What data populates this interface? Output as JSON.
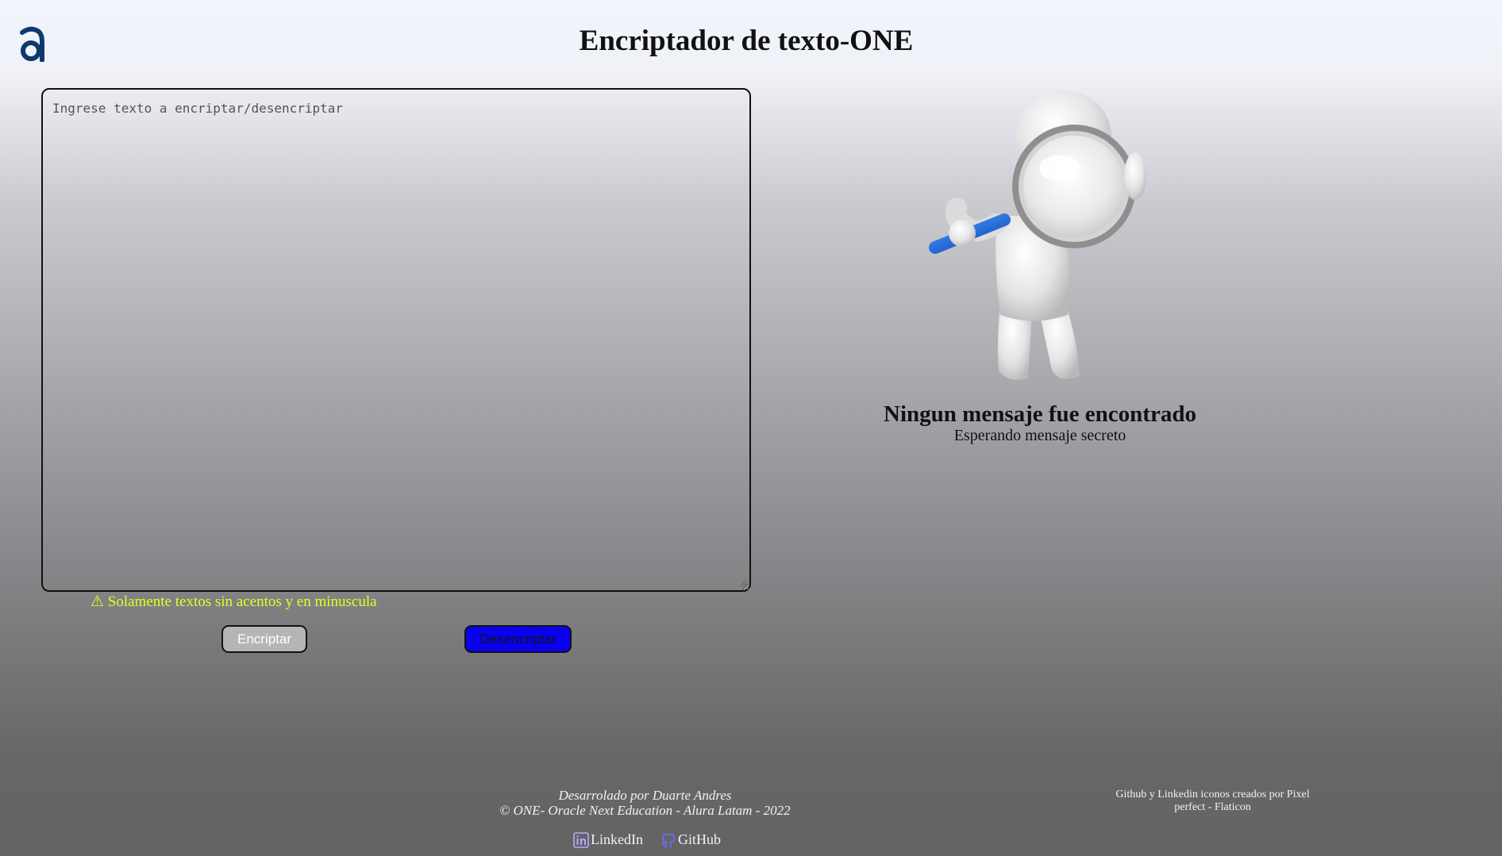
{
  "header": {
    "logo_icon": "alura-logo-icon",
    "title": "Encriptador de texto-ONE"
  },
  "input": {
    "placeholder": "Ingrese texto a encriptar/desencriptar",
    "value": ""
  },
  "warning": {
    "icon": "warning-icon",
    "text": "⚠ Solamente textos sin acentos y en minuscula"
  },
  "actions": {
    "encrypt_label": "Encriptar",
    "decrypt_label": "Desencriptar"
  },
  "output": {
    "image": "magnifier-figure-illustration",
    "title": "Ningun mensaje fue encontrado",
    "subtitle": "Esperando mensaje secreto"
  },
  "footer": {
    "developed_by": "Desarrolado por Duarte Andres",
    "copyright": "© ONE- Oracle Next Education - Alura Latam - 2022",
    "linkedin_label": "LinkedIn",
    "github_label": "GitHub",
    "icon_credit": "Github y Linkedin iconos creados por Pixel perfect - Flaticon"
  },
  "colors": {
    "warning": "#e6ff1a",
    "decrypt_button": "#0a00f0",
    "encrypt_button": "#b5b5b5",
    "logo": "#0d3a6e"
  }
}
